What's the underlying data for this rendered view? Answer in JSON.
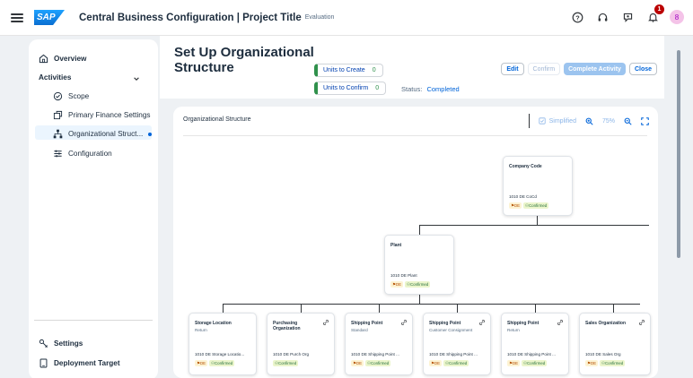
{
  "shell": {
    "title": "Central Business Configuration | Project Title",
    "subtitle": "Evaluation",
    "logo_text": "SAP",
    "notification_count": "1",
    "avatar_initial": "8",
    "icons": [
      "menu-icon",
      "help-icon",
      "headset-icon",
      "copilot-icon",
      "bell-icon"
    ]
  },
  "sidenav": {
    "overview": "Overview",
    "activities": "Activities",
    "items": [
      "Scope",
      "Primary Finance Settings",
      "Organizational Struct...",
      "Configuration"
    ],
    "settings": "Settings",
    "deployment": "Deployment Target"
  },
  "header": {
    "title": "Set Up Organizational Structure",
    "units_create_label": "Units to Create",
    "units_create_count": "0",
    "units_confirm_label": "Units to Confirm",
    "units_confirm_count": "0",
    "status_label": "Status:",
    "status_value": "Completed",
    "buttons": [
      "Edit",
      "Confirm",
      "Complete Activity",
      "Close"
    ]
  },
  "card": {
    "title": "Organizational Structure",
    "simplified_label": "Simplified",
    "zoom_level": "75%"
  },
  "nodes": {
    "company": {
      "title": "Company Code",
      "code": "1010 DE CoCd",
      "country": "DE",
      "status": "Confirmed"
    },
    "plant": {
      "title": "Plant",
      "code": "1010 DE Plant",
      "country": "DE",
      "status": "Confirmed"
    },
    "children": [
      {
        "title": "Storage Location",
        "sub": "Return",
        "code": "1010 DE Storage Locatio...",
        "country": "DE",
        "status": "Confirmed"
      },
      {
        "title": "Purchasing Organization",
        "sub": "",
        "code": "1010 DE Purch Org",
        "country": "",
        "status": "Confirmed"
      },
      {
        "title": "Shipping Point",
        "sub": "Standard",
        "code": "1010 DE Shipping Point ...",
        "country": "DE",
        "status": "Confirmed"
      },
      {
        "title": "Shipping Point",
        "sub": "Customer Consignment",
        "code": "1010 DE Shipping Point ...",
        "country": "DE",
        "status": "Confirmed"
      },
      {
        "title": "Shipping Point",
        "sub": "Return",
        "code": "1010 DE Shipping Point ...",
        "country": "DE",
        "status": "Confirmed"
      },
      {
        "title": "Sales Organization",
        "sub": "",
        "code": "1010 DE Sales Org",
        "country": "DE",
        "status": "Confirmed"
      }
    ]
  }
}
